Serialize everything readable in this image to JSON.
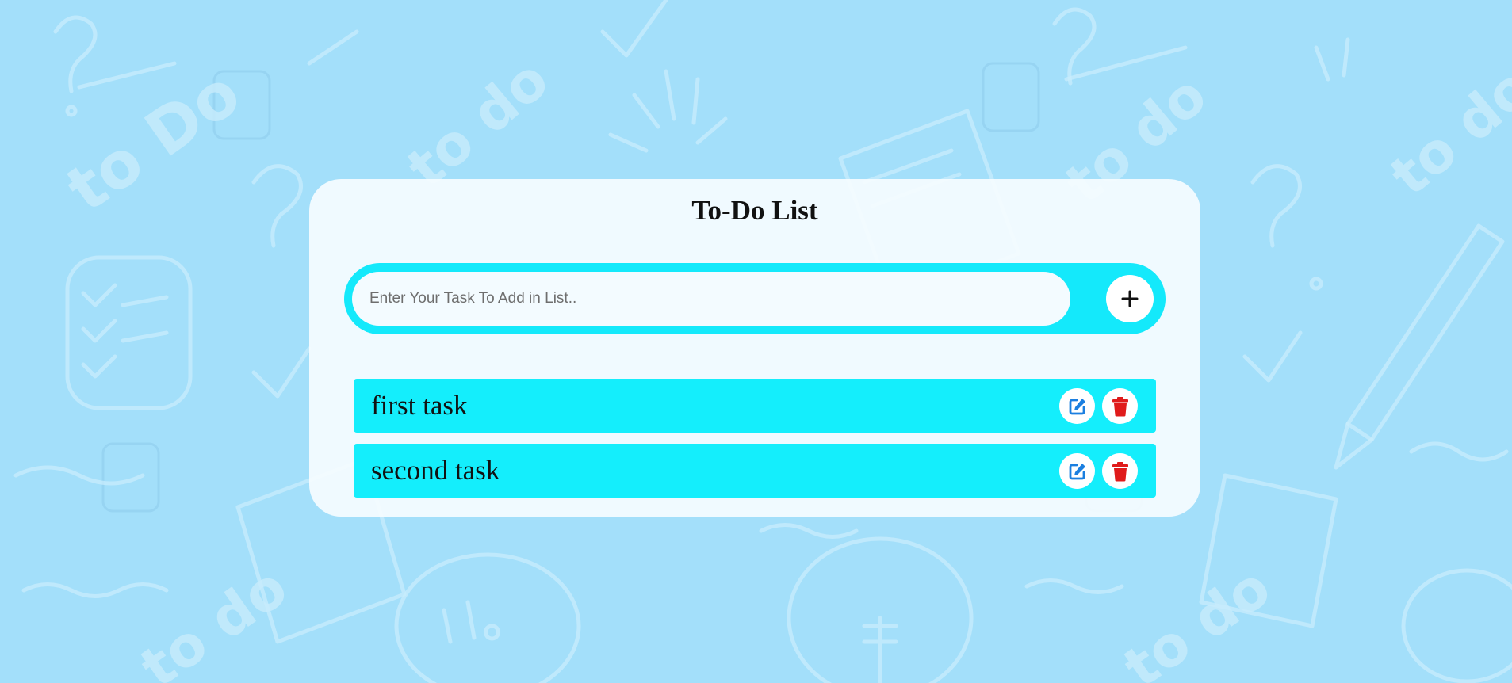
{
  "app": {
    "title": "To-Do List"
  },
  "input": {
    "placeholder": "Enter Your Task To Add in List..",
    "value": ""
  },
  "add_button": {
    "icon": "plus-icon"
  },
  "tasks": [
    {
      "text": "first task"
    },
    {
      "text": "second task"
    }
  ],
  "task_actions": {
    "edit_icon": "edit-icon",
    "delete_icon": "trash-icon"
  },
  "background": {
    "doodle_text": [
      "to Do",
      "to do",
      "?",
      "!!"
    ]
  },
  "colors": {
    "background": "#a3dffa",
    "accent": "#14e9fb",
    "card": "#f5fcff",
    "edit_icon": "#1b7fe0",
    "delete_icon": "#e01b1b"
  }
}
